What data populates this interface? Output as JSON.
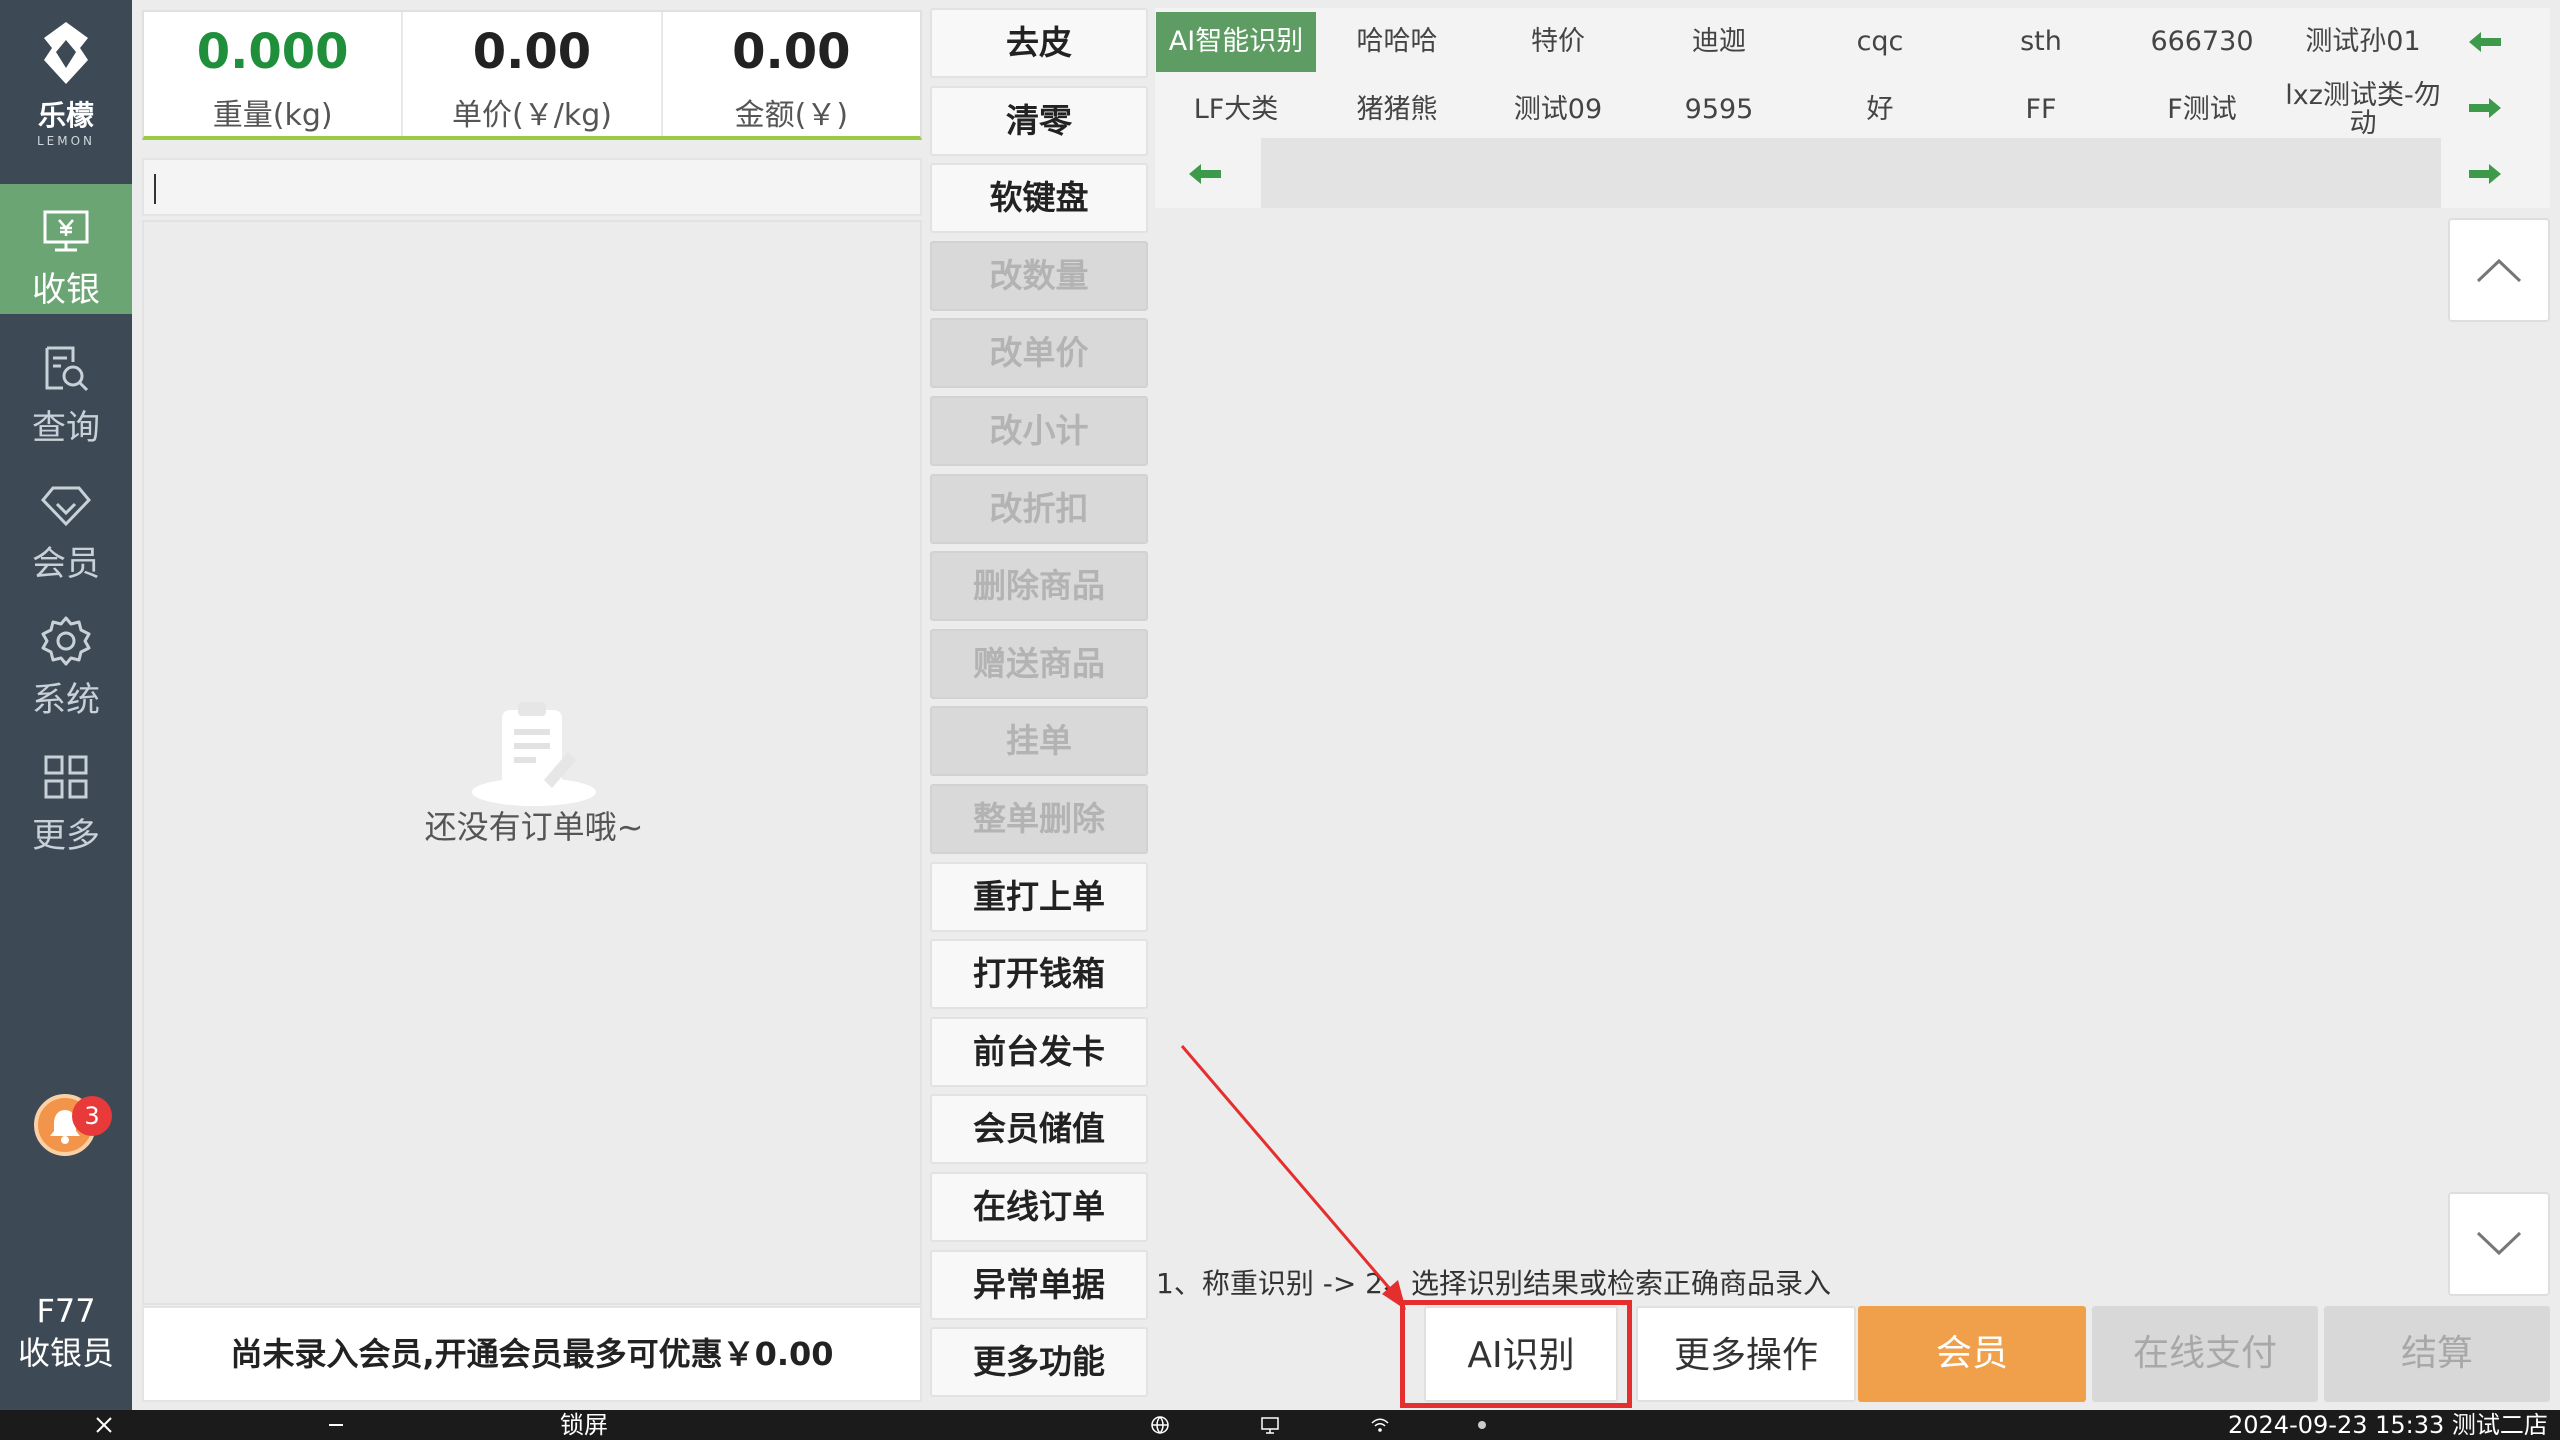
{
  "sidebar": {
    "logo_text": "乐檬",
    "logo_sub": "LEMON",
    "items": [
      {
        "label": "收银",
        "icon": "cashier-icon"
      },
      {
        "label": "查询",
        "icon": "query-icon"
      },
      {
        "label": "会员",
        "icon": "diamond-icon"
      },
      {
        "label": "系统",
        "icon": "gear-icon"
      },
      {
        "label": "更多",
        "icon": "grid-icon"
      }
    ],
    "notification_count": "3",
    "terminal_id": "F77",
    "role": "收银员"
  },
  "summary": {
    "weight_value": "0.000",
    "weight_label": "重量(kg)",
    "unit_price_value": "0.00",
    "unit_price_label": "单价(￥/kg)",
    "amount_value": "0.00",
    "amount_label": "金额(￥)"
  },
  "order": {
    "empty_text": "还没有订单哦~"
  },
  "member_bar": {
    "text": "尚未录入会员,开通会员最多可优惠￥0.00"
  },
  "functions": [
    {
      "label": "去皮",
      "enabled": true
    },
    {
      "label": "清零",
      "enabled": true
    },
    {
      "label": "软键盘",
      "enabled": true
    },
    {
      "label": "改数量",
      "enabled": false
    },
    {
      "label": "改单价",
      "enabled": false
    },
    {
      "label": "改小计",
      "enabled": false
    },
    {
      "label": "改折扣",
      "enabled": false
    },
    {
      "label": "删除商品",
      "enabled": false
    },
    {
      "label": "赠送商品",
      "enabled": false
    },
    {
      "label": "挂单",
      "enabled": false
    },
    {
      "label": "整单删除",
      "enabled": false
    },
    {
      "label": "重打上单",
      "enabled": true
    },
    {
      "label": "打开钱箱",
      "enabled": true
    },
    {
      "label": "前台发卡",
      "enabled": true
    },
    {
      "label": "会员储值",
      "enabled": true
    },
    {
      "label": "在线订单",
      "enabled": true
    },
    {
      "label": "异常单据",
      "enabled": true
    },
    {
      "label": "更多功能",
      "enabled": true
    }
  ],
  "categories": {
    "row1": [
      "AI智能识别",
      "哈哈哈",
      "特价",
      "迪迦",
      "cqc",
      "sth",
      "666730",
      "测试孙01"
    ],
    "row2": [
      "LF大类",
      "猪猪熊",
      "测试09",
      "9595",
      "好",
      "FF",
      "F测试",
      "lxz测试类-勿动"
    ],
    "active": "AI智能识别"
  },
  "hint": "1、称重识别 -> 2、选择识别结果或检索正确商品录入",
  "bottom_buttons": {
    "ai": "AI识别",
    "more_ops": "更多操作",
    "member": "会员",
    "online_pay": "在线支付",
    "checkout": "结算"
  },
  "taskbar": {
    "lock": "锁屏",
    "datetime": "2024-09-23 15:33",
    "store": "测试二店"
  },
  "colors": {
    "sidebar_bg": "#3d4955",
    "accent_green": "#5d9c62",
    "member_orange": "#f0a04b",
    "highlight_red": "#e52e2e"
  }
}
